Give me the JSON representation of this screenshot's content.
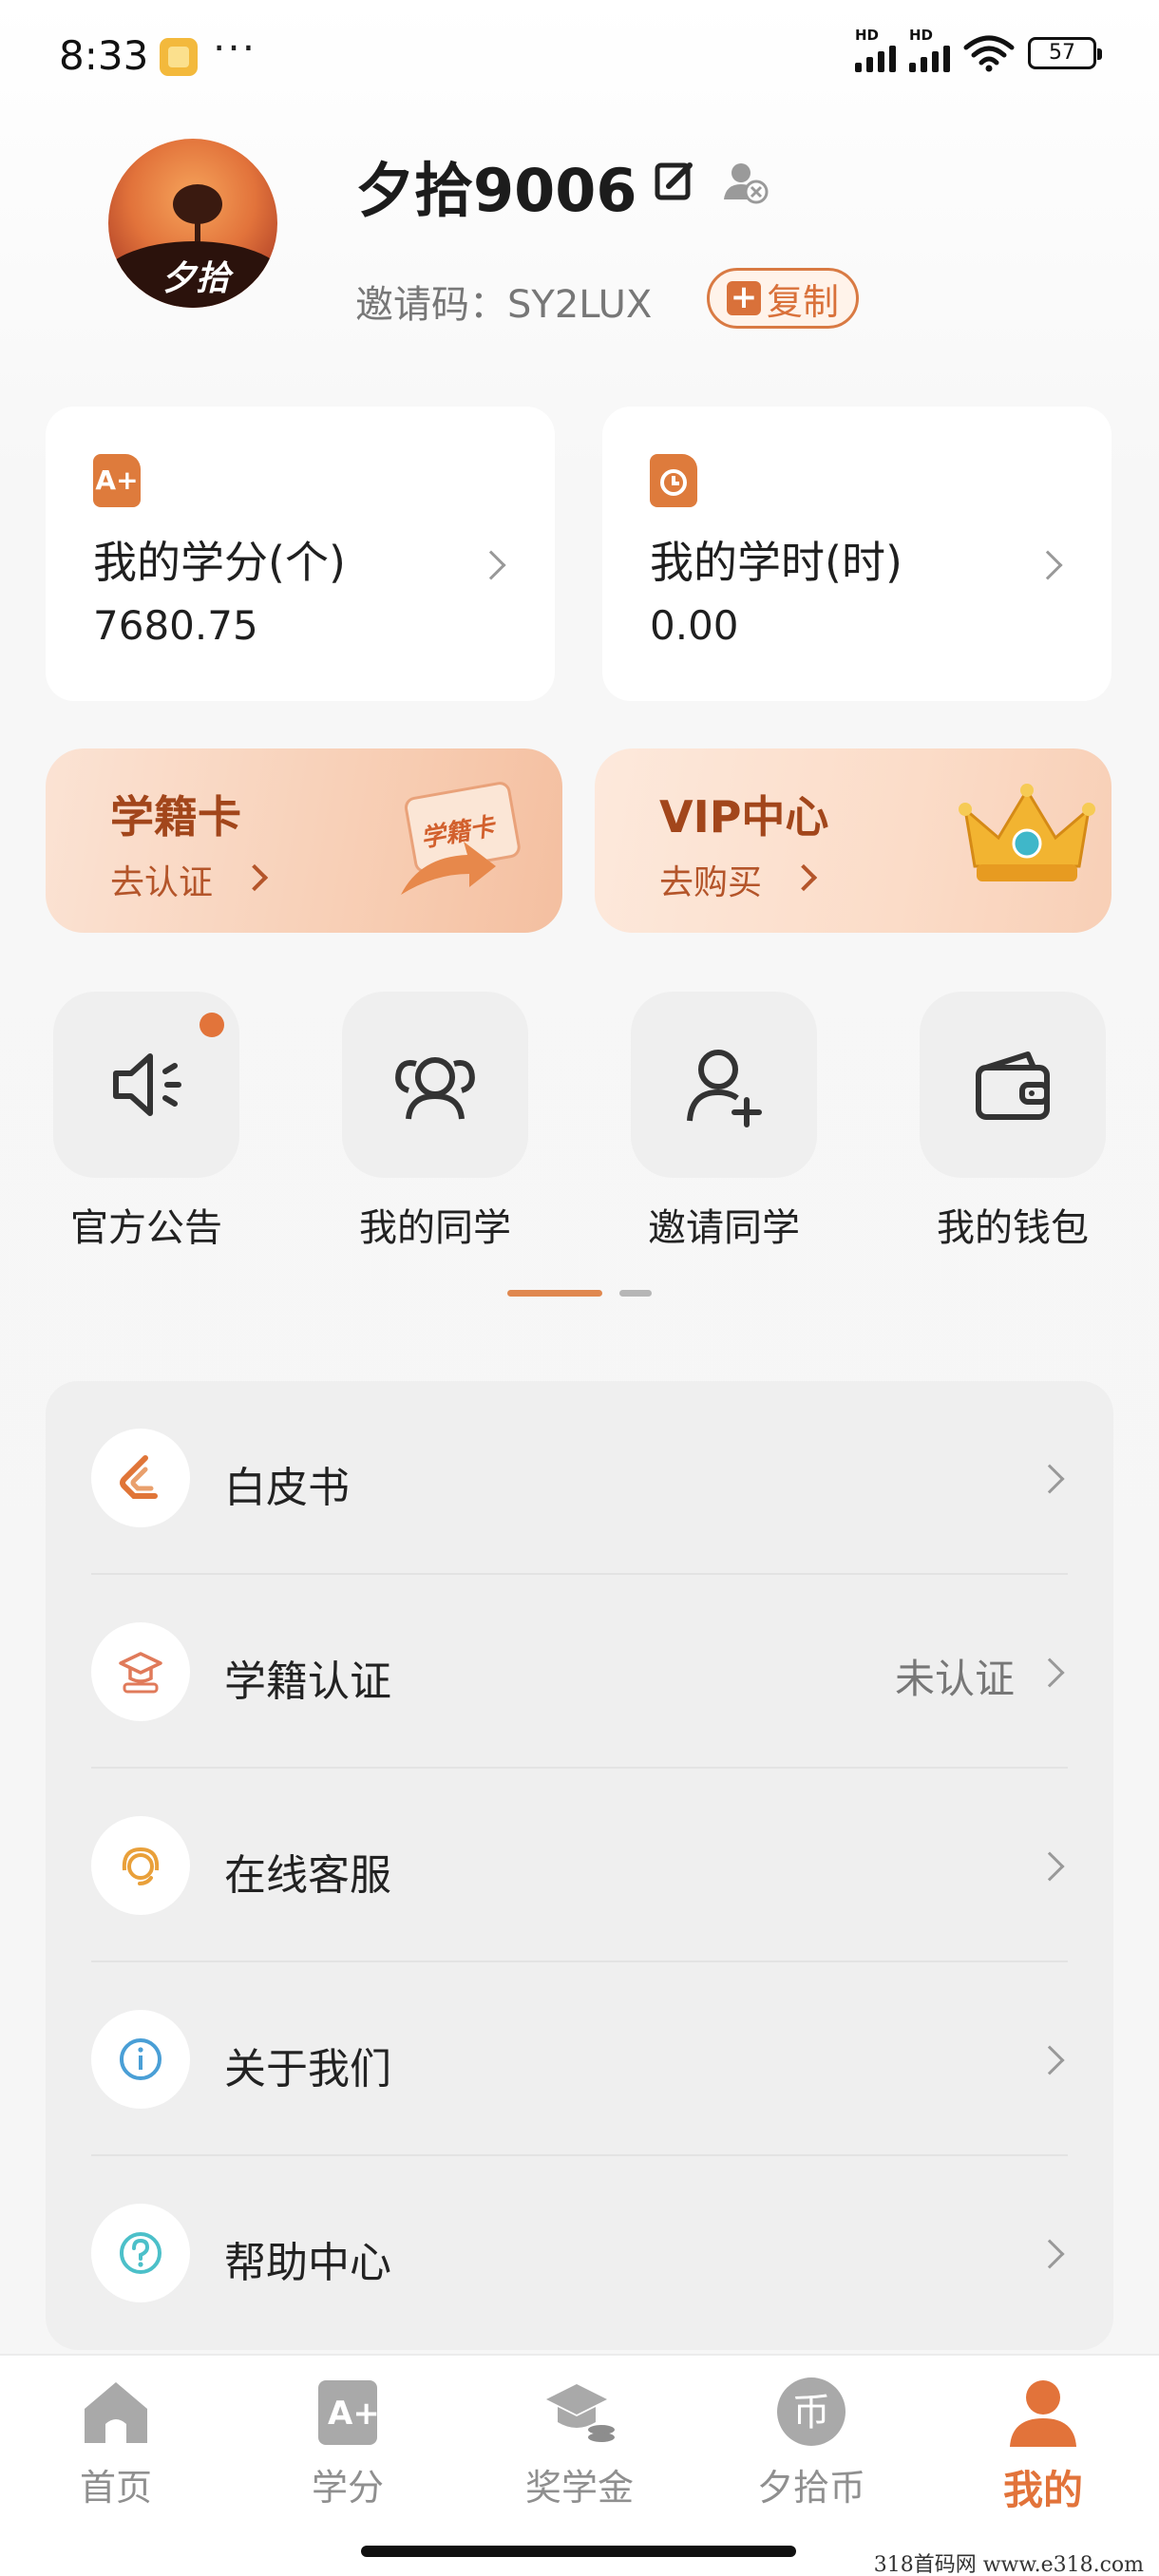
{
  "status_bar": {
    "time": "8:33",
    "more": "···",
    "hd1": "HD",
    "hd2": "HD",
    "battery": "57"
  },
  "profile": {
    "avatar_text": "夕拾",
    "username": "夕拾9006",
    "invite_label": "邀请码：SY2LUX",
    "copy_label": "复制"
  },
  "stats": [
    {
      "label": "我的学分(个)",
      "value": "7680.75",
      "icon": "credit-icon"
    },
    {
      "label": "我的学时(时)",
      "value": "0.00",
      "icon": "clock-icon"
    }
  ],
  "promos": [
    {
      "title": "学籍卡",
      "sub": "去认证",
      "art_text": "学籍卡"
    },
    {
      "title": "VIP中心",
      "sub": "去购买"
    }
  ],
  "quick_actions": [
    {
      "label": "官方公告",
      "icon": "speaker-icon"
    },
    {
      "label": "我的同学",
      "icon": "classmates-icon"
    },
    {
      "label": "邀请同学",
      "icon": "add-person-icon"
    },
    {
      "label": "我的钱包",
      "icon": "wallet-icon"
    }
  ],
  "menu": [
    {
      "label": "白皮书",
      "status": "",
      "icon": "whitepaper-icon"
    },
    {
      "label": "学籍认证",
      "status": "未认证",
      "icon": "graduation-cap-icon"
    },
    {
      "label": "在线客服",
      "status": "",
      "icon": "headset-icon"
    },
    {
      "label": "关于我们",
      "status": "",
      "icon": "info-icon"
    },
    {
      "label": "帮助中心",
      "status": "",
      "icon": "help-icon"
    }
  ],
  "tabs": [
    {
      "label": "首页",
      "icon": "home-icon"
    },
    {
      "label": "学分",
      "icon": "credit-tab-icon"
    },
    {
      "label": "奖学金",
      "icon": "scholarship-icon"
    },
    {
      "label": "夕拾币",
      "icon": "coin-icon",
      "glyph": "币"
    },
    {
      "label": "我的",
      "icon": "profile-icon"
    }
  ],
  "colors": {
    "accent": "#e2733a",
    "brand_dark": "#a2461b"
  },
  "watermark": "318首码网  www.e318.com"
}
